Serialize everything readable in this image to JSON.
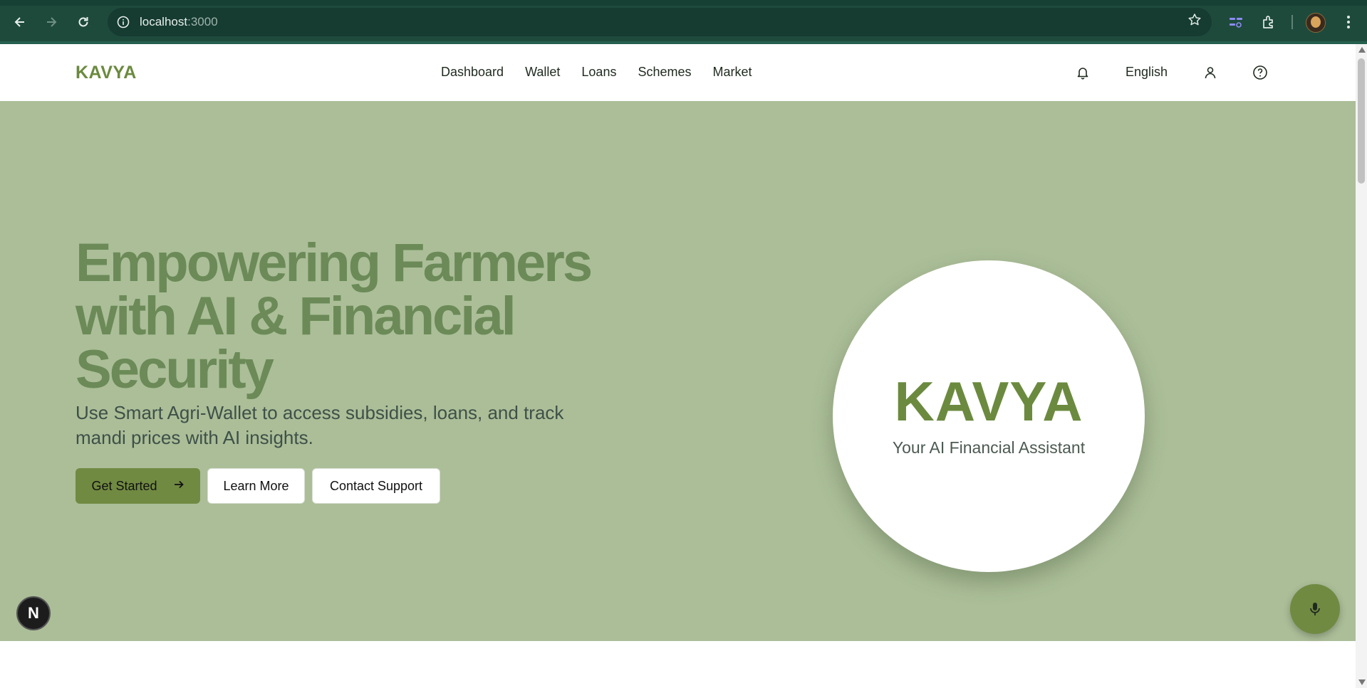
{
  "browser": {
    "url_host": "localhost",
    "url_port": ":3000"
  },
  "header": {
    "logo": "KAVYA",
    "nav": [
      "Dashboard",
      "Wallet",
      "Loans",
      "Schemes",
      "Market"
    ],
    "language": "English"
  },
  "hero": {
    "title": "Empowering Farmers with AI & Financial Security",
    "subtitle": "Use Smart Agri-Wallet to access subsidies, loans, and track mandi prices with AI insights.",
    "primary_button": "Get Started",
    "secondary_button": "Learn More",
    "tertiary_button": "Contact Support",
    "circle_title": "KAVYA",
    "circle_tagline": "Your AI Financial Assistant"
  },
  "floating": {
    "badge_letter": "N"
  },
  "colors": {
    "brand": "#6b8a3f",
    "hero_bg": "#abbe98",
    "button": "#718a42",
    "chrome": "#1e4a3c"
  },
  "icons": [
    "back-icon",
    "forward-icon",
    "reload-icon",
    "info-icon",
    "star-icon",
    "extension-icon",
    "puzzle-icon",
    "menu-icon",
    "bell-icon",
    "user-icon",
    "help-icon",
    "arrow-right-icon",
    "mic-icon"
  ]
}
